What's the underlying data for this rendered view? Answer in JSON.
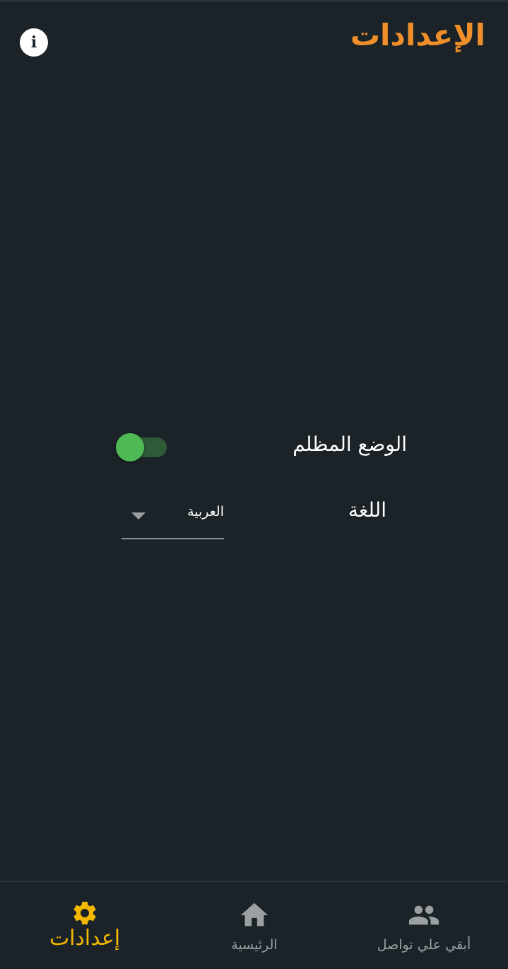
{
  "header": {
    "title": "الإعدادات",
    "info_icon": "info-icon"
  },
  "settings": {
    "dark_mode": {
      "label": "الوضع المظلم",
      "enabled": true
    },
    "language": {
      "label": "اللغة",
      "selected": "العربية"
    }
  },
  "bottom_nav": {
    "items": [
      {
        "label": "إعدادات",
        "icon": "gear-icon",
        "active": true
      },
      {
        "label": "الرئيسية",
        "icon": "home-icon",
        "active": false
      },
      {
        "label": "أبقي علي تواصل",
        "icon": "people-icon",
        "active": false
      }
    ]
  },
  "colors": {
    "background": "#1b2328",
    "title": "#ee8f2a",
    "active_nav": "#f5b800",
    "inactive_nav": "#9ba0a3",
    "toggle_on": "#4fba55"
  }
}
